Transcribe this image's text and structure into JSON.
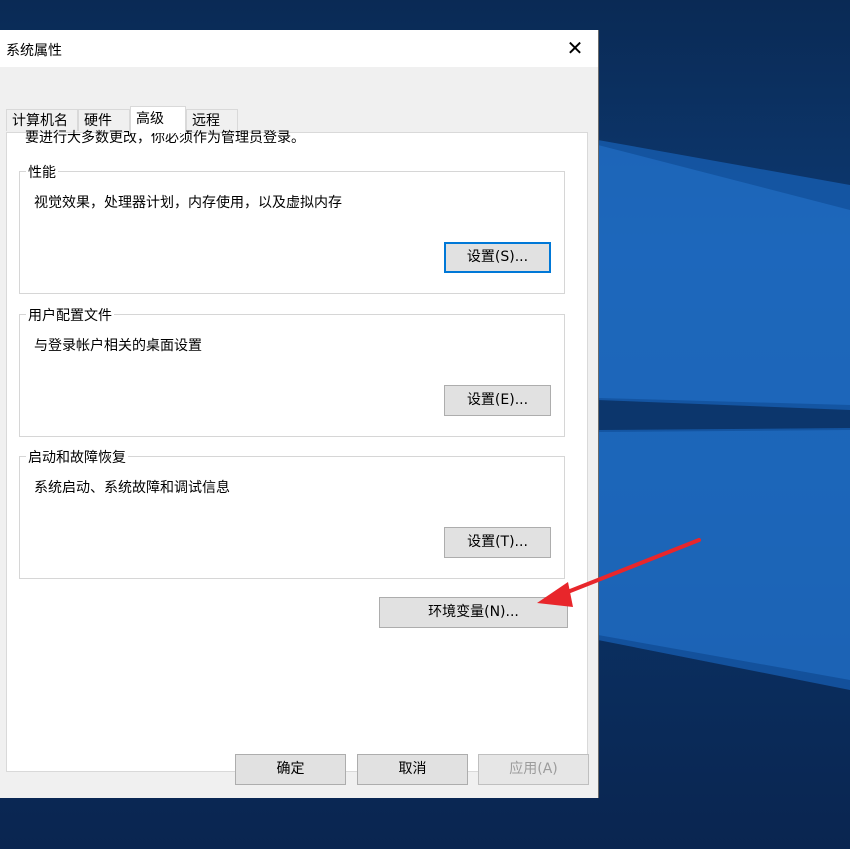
{
  "desktop": {
    "background_color": "#0d3a73"
  },
  "window": {
    "title": "系统属性",
    "close_glyph": "✕"
  },
  "tabs": [
    {
      "label": "计算机名"
    },
    {
      "label": "硬件"
    },
    {
      "label": "高级",
      "active": true
    },
    {
      "label": "远程"
    }
  ],
  "advanced": {
    "admin_note": "要进行大多数更改，你必须作为管理员登录。",
    "performance": {
      "title": "性能",
      "desc": "视觉效果，处理器计划，内存使用，以及虚拟内存",
      "button": "设置(S)..."
    },
    "profiles": {
      "title": "用户配置文件",
      "desc": "与登录帐户相关的桌面设置",
      "button": "设置(E)..."
    },
    "startup": {
      "title": "启动和故障恢复",
      "desc": "系统启动、系统故障和调试信息",
      "button": "设置(T)..."
    },
    "env_button": "环境变量(N)..."
  },
  "footer": {
    "ok": "确定",
    "cancel": "取消",
    "apply": "应用(A)"
  },
  "annotation": {
    "arrow_color": "#e8262b",
    "icon": "arrow-annotation"
  }
}
